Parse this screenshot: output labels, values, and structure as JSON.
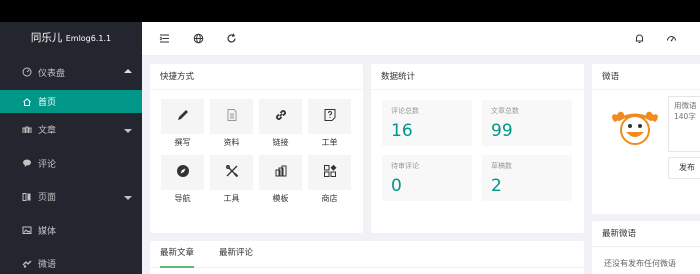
{
  "brand": {
    "name": "同乐儿",
    "version": "Emlog6.1.1"
  },
  "sidebar": {
    "items": [
      {
        "label": "仪表盘",
        "icon": "dashboard-icon"
      },
      {
        "label": "首页",
        "icon": "home-icon"
      },
      {
        "label": "文章",
        "icon": "article-icon"
      },
      {
        "label": "评论",
        "icon": "comment-icon"
      },
      {
        "label": "页面",
        "icon": "page-icon"
      },
      {
        "label": "媒体",
        "icon": "media-icon"
      },
      {
        "label": "微语",
        "icon": "twitter-icon"
      }
    ]
  },
  "header": {
    "icons": [
      "menu-toggle-icon",
      "globe-icon",
      "refresh-icon",
      "bell-icon",
      "theme-icon"
    ]
  },
  "shortcuts": {
    "title": "快捷方式",
    "items": [
      {
        "label": "撰写",
        "icon": "pencil-icon"
      },
      {
        "label": "资料",
        "icon": "document-icon"
      },
      {
        "label": "链接",
        "icon": "link-icon"
      },
      {
        "label": "工单",
        "icon": "help-icon"
      },
      {
        "label": "导航",
        "icon": "compass-icon"
      },
      {
        "label": "工具",
        "icon": "tools-icon"
      },
      {
        "label": "模板",
        "icon": "template-icon"
      },
      {
        "label": "商店",
        "icon": "store-icon"
      }
    ]
  },
  "stats": {
    "title": "数据统计",
    "items": [
      {
        "label": "评论总数",
        "value": "16"
      },
      {
        "label": "文章总数",
        "value": "99"
      },
      {
        "label": "待审评论",
        "value": "0"
      },
      {
        "label": "草稿数",
        "value": "2"
      }
    ]
  },
  "weiyu": {
    "title": "微语",
    "placeholder": "用微语\n140字",
    "publish_label": "发布"
  },
  "latest_weiyu": {
    "title": "最新微语",
    "empty_text": "还没有发布任何微语"
  },
  "articles": {
    "tabs": [
      "最新文章",
      "最新评论"
    ]
  },
  "colors": {
    "accent": "#009688",
    "sidebar": "#23262e",
    "tab_underline": "#5fb878",
    "mascot": "#f08c1e"
  }
}
